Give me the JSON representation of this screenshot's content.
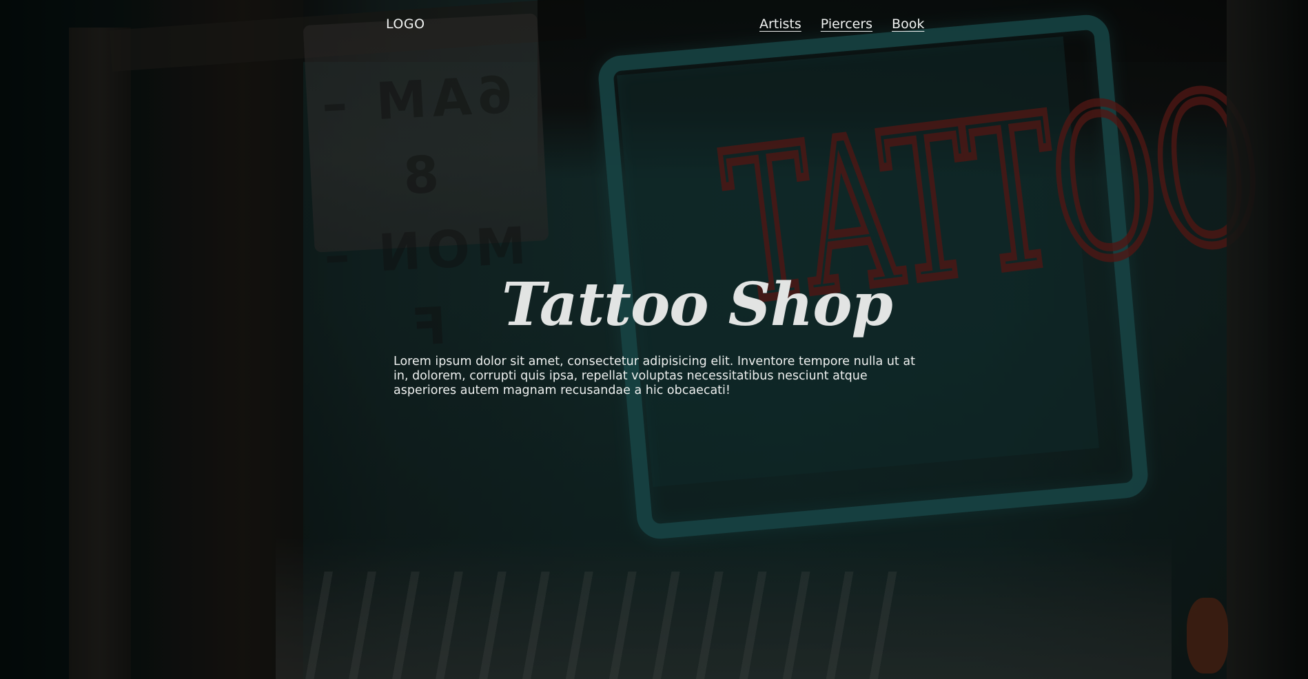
{
  "header": {
    "logo_text": "LOGO",
    "nav_items": [
      {
        "label": "Artists"
      },
      {
        "label": "Piercers"
      },
      {
        "label": "Book"
      }
    ]
  },
  "hero": {
    "title": "Tattoo Shop",
    "description": "Lorem ipsum dolor sit amet, consectetur adipisicing elit. Inventore tempore nulla ut at in, dolorem, corrupti quis ipsa, repellat voluptas necessitatibus nesciunt atque asperiores autem magnam recusandae a hic obcaecati!"
  },
  "background": {
    "overlay_color": "#000000",
    "neon_sign_color": "#8f2a24",
    "neon_frame_color": "#2b7f80"
  }
}
